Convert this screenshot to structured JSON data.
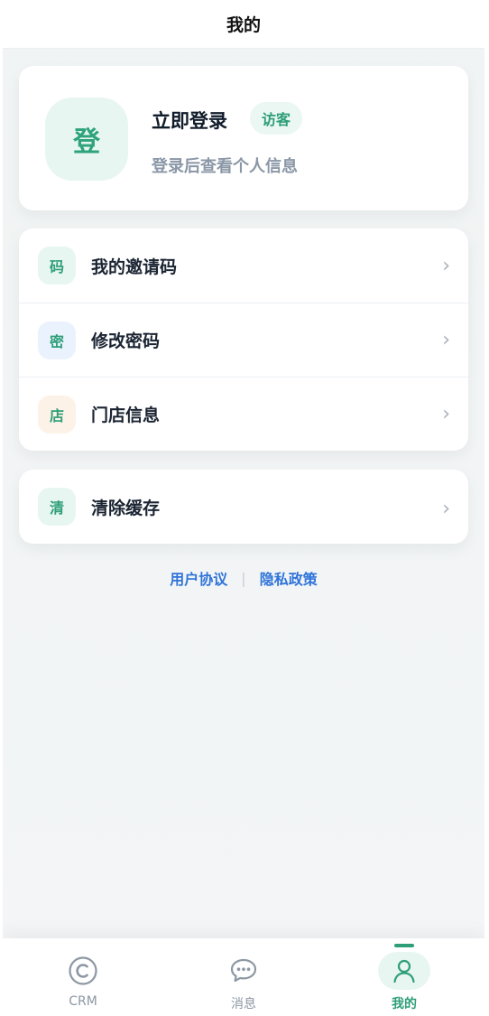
{
  "header": {
    "title": "我的"
  },
  "profile": {
    "avatar_char": "登",
    "title": "立即登录",
    "badge": "访客",
    "subtitle": "登录后查看个人信息"
  },
  "menu_group_1": [
    {
      "icon_char": "码",
      "label": "我的邀请码",
      "icon_bg": "#e7f6f0",
      "icon_color": "#2e9e78"
    },
    {
      "icon_char": "密",
      "label": "修改密码",
      "icon_bg": "#eaf3fd",
      "icon_color": "#2e9e78"
    },
    {
      "icon_char": "店",
      "label": "门店信息",
      "icon_bg": "#fdf2e7",
      "icon_color": "#2e9e78"
    }
  ],
  "menu_group_2": [
    {
      "icon_char": "清",
      "label": "清除缓存",
      "icon_bg": "#e7f6f0",
      "icon_color": "#2e9e78"
    }
  ],
  "chevron": "›",
  "footer_links": {
    "agreement": "用户协议",
    "separator": "|",
    "privacy": "隐私政策"
  },
  "tabs": [
    {
      "label": "CRM",
      "icon": "crm-c-icon",
      "active": false
    },
    {
      "label": "消息",
      "icon": "chat-bubble-icon",
      "active": false
    },
    {
      "label": "我的",
      "icon": "person-icon",
      "active": true
    }
  ],
  "colors": {
    "accent": "#2e9e78",
    "link": "#2f74d9"
  }
}
